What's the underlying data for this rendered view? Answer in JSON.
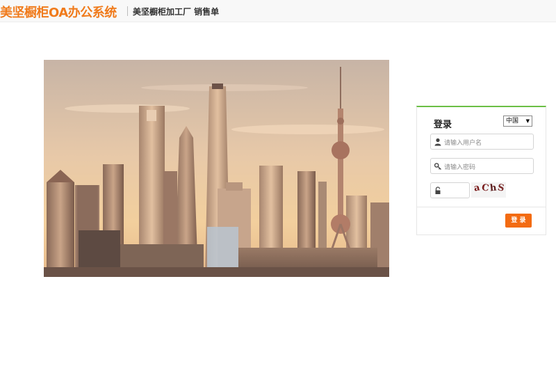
{
  "header": {
    "brand": "美坚橱柜OA办公系统",
    "subtitle": "美坚橱柜加工厂 销售单"
  },
  "hero": {
    "description_icon": "city-skyline-image"
  },
  "login": {
    "title": "登录",
    "region_selected": "中国",
    "username_placeholder": "请输入用户名",
    "password_placeholder": "请输入密码",
    "captcha_text": [
      "a",
      "C",
      "h",
      "S"
    ],
    "submit_label": "登 录"
  },
  "colors": {
    "brand_orange": "#f07b1c",
    "button_orange": "#f36b12",
    "panel_accent_green": "#6bbf45"
  }
}
